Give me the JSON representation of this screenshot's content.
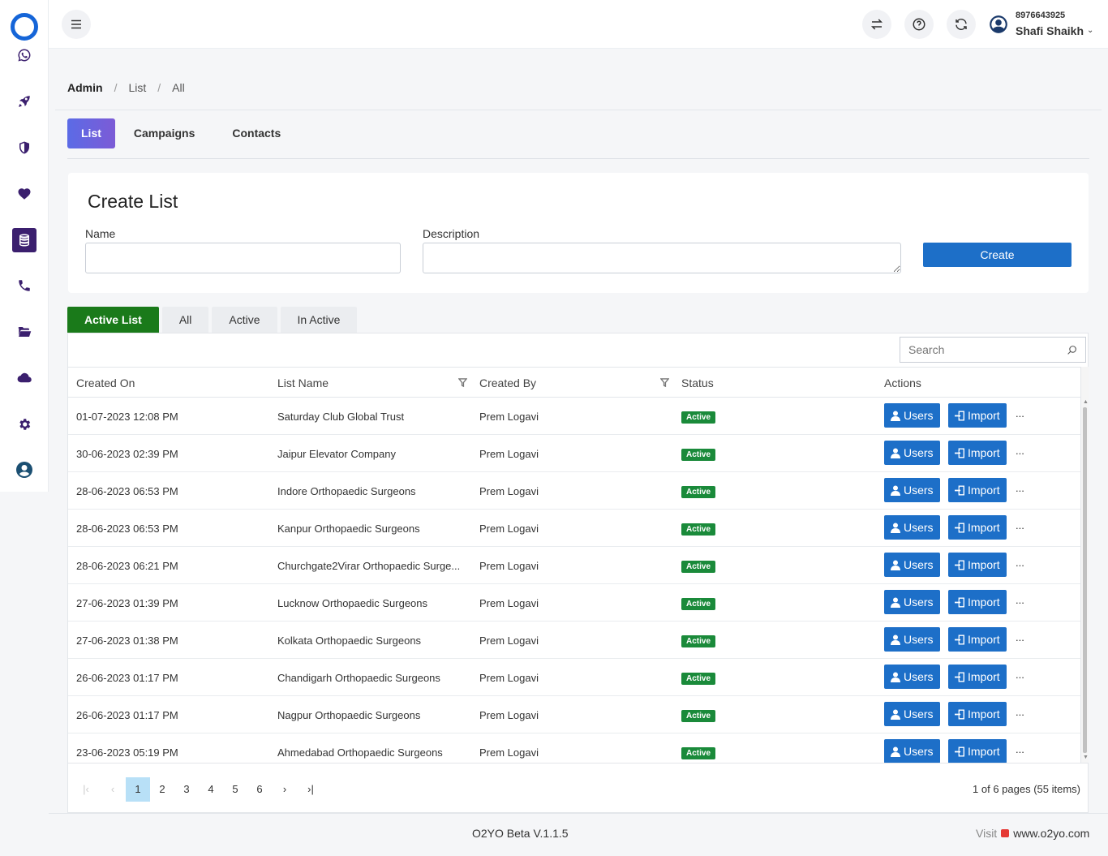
{
  "header": {
    "phone": "8976643925",
    "user_name": "Shafi Shaikh"
  },
  "breadcrumb": [
    "Admin",
    "List",
    "All"
  ],
  "tabs": [
    {
      "label": "List",
      "active": true
    },
    {
      "label": "Campaigns",
      "active": false
    },
    {
      "label": "Contacts",
      "active": false
    }
  ],
  "create": {
    "title": "Create List",
    "name_label": "Name",
    "name_value": "",
    "description_label": "Description",
    "description_value": "",
    "create_label": "Create"
  },
  "filter_tabs": [
    {
      "label": "Active List",
      "active": true
    },
    {
      "label": "All",
      "active": false
    },
    {
      "label": "Active",
      "active": false
    },
    {
      "label": "In Active",
      "active": false
    }
  ],
  "grid": {
    "search_placeholder": "Search",
    "columns": [
      "Created On",
      "List Name",
      "Created By",
      "Status",
      "Actions"
    ],
    "users_label": "Users",
    "import_label": "Import",
    "more_label": "...",
    "rows": [
      {
        "created_on": "01-07-2023 12:08 PM",
        "list_name": "Saturday Club Global Trust",
        "created_by": "Prem Logavi",
        "status": "Active"
      },
      {
        "created_on": "30-06-2023 02:39 PM",
        "list_name": "Jaipur Elevator Company",
        "created_by": "Prem Logavi",
        "status": "Active"
      },
      {
        "created_on": "28-06-2023 06:53 PM",
        "list_name": "Indore Orthopaedic Surgeons",
        "created_by": "Prem Logavi",
        "status": "Active"
      },
      {
        "created_on": "28-06-2023 06:53 PM",
        "list_name": "Kanpur Orthopaedic Surgeons",
        "created_by": "Prem Logavi",
        "status": "Active"
      },
      {
        "created_on": "28-06-2023 06:21 PM",
        "list_name": "Churchgate2Virar Orthopaedic Surge...",
        "created_by": "Prem Logavi",
        "status": "Active"
      },
      {
        "created_on": "27-06-2023 01:39 PM",
        "list_name": "Lucknow Orthopaedic Surgeons",
        "created_by": "Prem Logavi",
        "status": "Active"
      },
      {
        "created_on": "27-06-2023 01:38 PM",
        "list_name": "Kolkata Orthopaedic Surgeons",
        "created_by": "Prem Logavi",
        "status": "Active"
      },
      {
        "created_on": "26-06-2023 01:17 PM",
        "list_name": "Chandigarh Orthopaedic Surgeons",
        "created_by": "Prem Logavi",
        "status": "Active"
      },
      {
        "created_on": "26-06-2023 01:17 PM",
        "list_name": "Nagpur Orthopaedic Surgeons",
        "created_by": "Prem Logavi",
        "status": "Active"
      },
      {
        "created_on": "23-06-2023 05:19 PM",
        "list_name": "Ahmedabad Orthopaedic Surgeons",
        "created_by": "Prem Logavi",
        "status": "Active"
      }
    ]
  },
  "pager": {
    "pages": [
      "1",
      "2",
      "3",
      "4",
      "5",
      "6"
    ],
    "current": "1",
    "info": "1 of 6 pages (55 items)"
  },
  "footer": {
    "version": "O2YO Beta V.1.1.5",
    "visit_label": "Visit",
    "site": "www.o2yo.com"
  },
  "colors": {
    "primary": "#1d6fc8",
    "sidebar_accent": "#3b1f6e",
    "active_green": "#1a7a1a",
    "status_badge": "#1a8a3a"
  }
}
